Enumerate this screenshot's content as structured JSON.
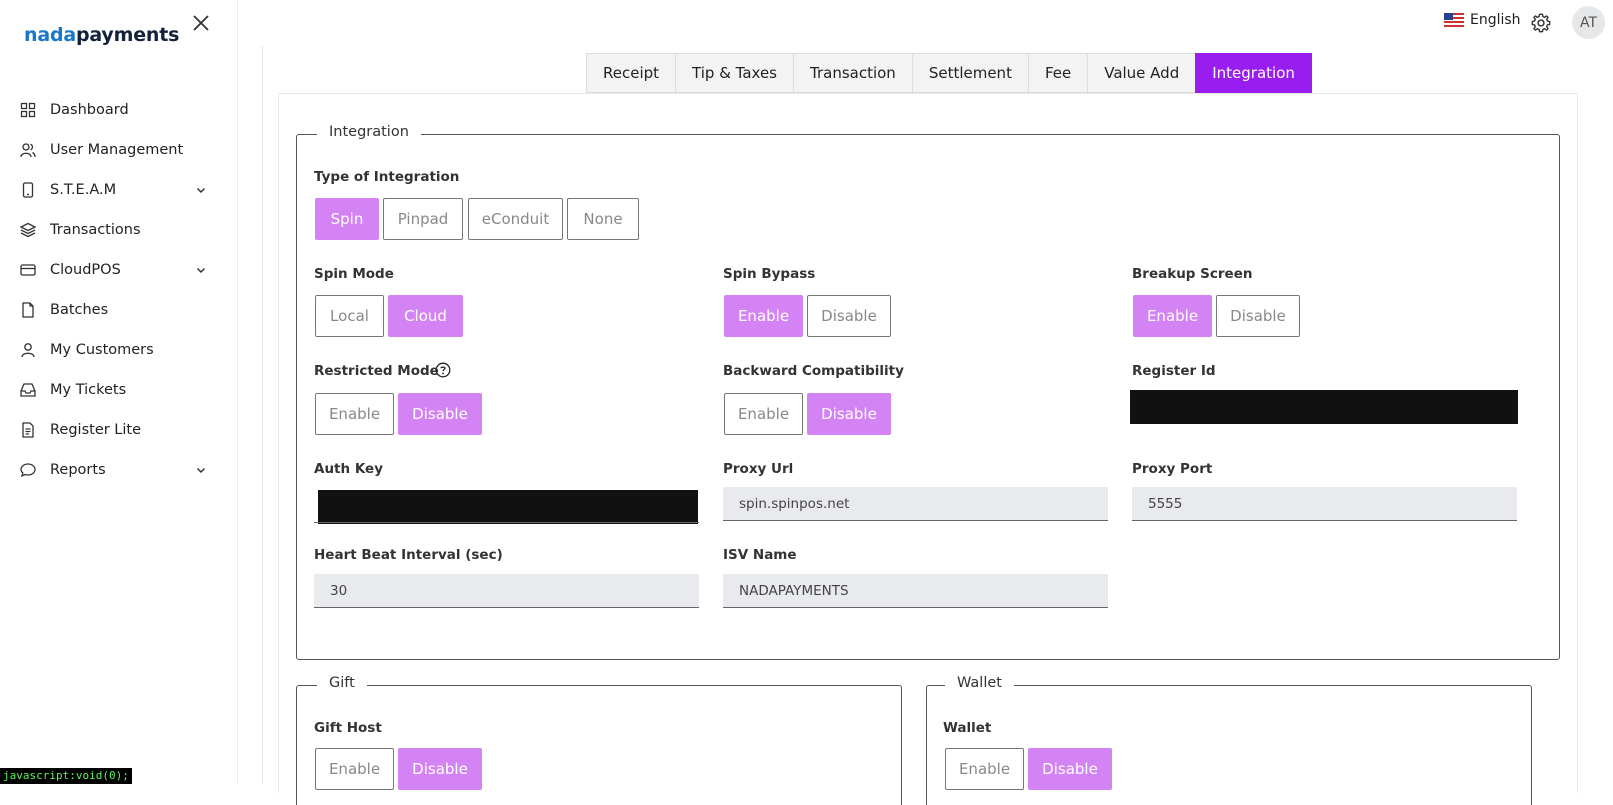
{
  "brand": {
    "part1": "nada",
    "part2": "payments"
  },
  "sidebar": {
    "items": [
      {
        "label": "Dashboard",
        "icon": "grid-icon",
        "chevron": false
      },
      {
        "label": "User Management",
        "icon": "users-icon",
        "chevron": false
      },
      {
        "label": "S.T.E.A.M",
        "icon": "device-icon",
        "chevron": true
      },
      {
        "label": "Transactions",
        "icon": "layers-icon",
        "chevron": false
      },
      {
        "label": "CloudPOS",
        "icon": "card-icon",
        "chevron": true
      },
      {
        "label": "Batches",
        "icon": "file-icon",
        "chevron": false
      },
      {
        "label": "My Customers",
        "icon": "user-icon",
        "chevron": false
      },
      {
        "label": "My Tickets",
        "icon": "inbox-icon",
        "chevron": false
      },
      {
        "label": "Register Lite",
        "icon": "document-icon",
        "chevron": false
      },
      {
        "label": "Reports",
        "icon": "chat-icon",
        "chevron": true
      }
    ]
  },
  "status_bar": "javascript:void(0);",
  "header": {
    "language": "English",
    "avatar_initials": "AT"
  },
  "tabs": [
    "Receipt",
    "Tip & Taxes",
    "Transaction",
    "Settlement",
    "Fee",
    "Value Add",
    "Integration"
  ],
  "active_tab": "Integration",
  "integration": {
    "legend": "Integration",
    "type_label": "Type of Integration",
    "type_options": [
      "Spin",
      "Pinpad",
      "eConduit",
      "None"
    ],
    "type_selected": "Spin",
    "spin_mode": {
      "label": "Spin Mode",
      "options": [
        "Local",
        "Cloud"
      ],
      "selected": "Cloud"
    },
    "spin_bypass": {
      "label": "Spin Bypass",
      "options": [
        "Enable",
        "Disable"
      ],
      "selected": "Enable"
    },
    "breakup_screen": {
      "label": "Breakup Screen",
      "options": [
        "Enable",
        "Disable"
      ],
      "selected": "Enable"
    },
    "restricted_mode": {
      "label": "Restricted Mode",
      "options": [
        "Enable",
        "Disable"
      ],
      "selected": "Disable"
    },
    "backward_compat": {
      "label": "Backward Compatibility",
      "options": [
        "Enable",
        "Disable"
      ],
      "selected": "Disable"
    },
    "register_id": {
      "label": "Register Id"
    },
    "auth_key": {
      "label": "Auth Key"
    },
    "proxy_url": {
      "label": "Proxy Url",
      "value": "spin.spinpos.net"
    },
    "proxy_port": {
      "label": "Proxy Port",
      "value": "5555"
    },
    "heartbeat": {
      "label": "Heart Beat Interval (sec)",
      "value": "30"
    },
    "isv_name": {
      "label": "ISV Name",
      "value": "NADAPAYMENTS"
    }
  },
  "gift": {
    "legend": "Gift",
    "label": "Gift Host",
    "options": [
      "Enable",
      "Disable"
    ],
    "selected": "Disable"
  },
  "wallet": {
    "legend": "Wallet",
    "label": "Wallet",
    "options": [
      "Enable",
      "Disable"
    ],
    "selected": "Disable"
  },
  "colors": {
    "accent": "#9a1df0",
    "selected_button": "#d483f4",
    "brand_blue": "#1877c9"
  }
}
